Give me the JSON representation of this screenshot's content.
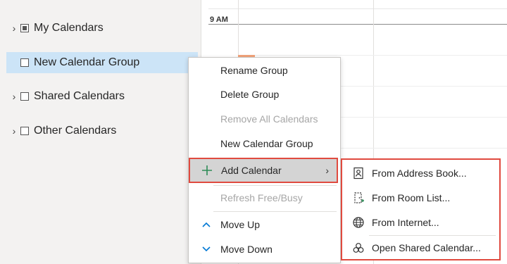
{
  "nav": {
    "groups": [
      {
        "label": "My Calendars",
        "expand_icon": "chevron-right-icon",
        "checkbox": "partial"
      },
      {
        "label": "New Calendar Group",
        "expand_icon": "",
        "checkbox": "unchecked",
        "selected": true
      },
      {
        "label": "Shared Calendars",
        "expand_icon": "chevron-right-icon",
        "checkbox": "unchecked"
      },
      {
        "label": "Other Calendars",
        "expand_icon": "chevron-right-icon",
        "checkbox": "unchecked"
      }
    ]
  },
  "calendar": {
    "time_label": "9 AM"
  },
  "context_menu": {
    "items": [
      {
        "label": "Rename Group",
        "enabled": true
      },
      {
        "label": "Delete Group",
        "enabled": true
      },
      {
        "label": "Remove All Calendars",
        "enabled": false
      },
      {
        "label": "New Calendar Group",
        "enabled": true
      },
      {
        "label": "Add Calendar",
        "enabled": true,
        "icon": "plus-icon",
        "has_submenu": true,
        "highlighted": true
      },
      {
        "label": "Refresh Free/Busy",
        "enabled": false
      },
      {
        "label": "Move Up",
        "enabled": true,
        "icon": "chevron-up-icon"
      },
      {
        "label": "Move Down",
        "enabled": true,
        "icon": "chevron-down-icon"
      }
    ]
  },
  "submenu": {
    "items": [
      {
        "label": "From Address Book...",
        "icon": "address-book-icon"
      },
      {
        "label": "From Room List...",
        "icon": "room-list-icon"
      },
      {
        "label": "From Internet...",
        "icon": "globe-icon"
      },
      {
        "label": "Open Shared Calendar...",
        "icon": "shared-calendar-icon"
      }
    ]
  },
  "colors": {
    "accent": "#0078d4",
    "highlight_outline": "#e04a3f",
    "selection": "#cce4f7",
    "add_icon": "#2e8b57"
  }
}
